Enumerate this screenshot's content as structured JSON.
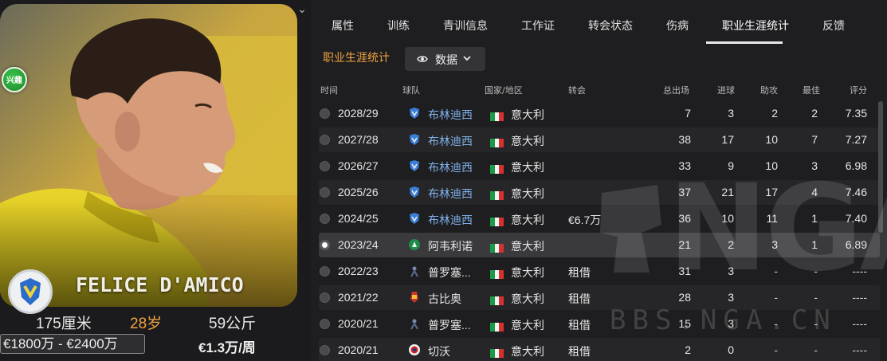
{
  "player": {
    "name": "FELICE D'AMICO",
    "height": "175厘米",
    "age": "28岁",
    "weight": "59公斤",
    "value": "€1800万 - €2400万",
    "wage": "€1.3万/周",
    "interest_badge": "兴趣"
  },
  "tabs": [
    {
      "label": "属性"
    },
    {
      "label": "训练"
    },
    {
      "label": "青训信息"
    },
    {
      "label": "工作证"
    },
    {
      "label": "转会状态"
    },
    {
      "label": "伤病"
    },
    {
      "label": "职业生涯统计"
    },
    {
      "label": "反馈"
    }
  ],
  "active_tab": "职业生涯统计",
  "section": {
    "title": "职业生涯统计",
    "view_button": "数据"
  },
  "table": {
    "headers": {
      "time": "时间",
      "team": "球队",
      "country": "国家/地区",
      "transfer": "转会",
      "apps": "总出场",
      "goals": "进球",
      "assists": "助攻",
      "motm": "最佳",
      "rating": "评分"
    },
    "rows": [
      {
        "season": "2028/29",
        "club": "布林迪西",
        "country": "意大利",
        "fee": "",
        "apps": "7",
        "goals": "3",
        "assists": "2",
        "motm": "2",
        "rating": "7.35"
      },
      {
        "season": "2027/28",
        "club": "布林迪西",
        "country": "意大利",
        "fee": "",
        "apps": "38",
        "goals": "17",
        "assists": "10",
        "motm": "7",
        "rating": "7.27"
      },
      {
        "season": "2026/27",
        "club": "布林迪西",
        "country": "意大利",
        "fee": "",
        "apps": "33",
        "goals": "9",
        "assists": "10",
        "motm": "3",
        "rating": "6.98"
      },
      {
        "season": "2025/26",
        "club": "布林迪西",
        "country": "意大利",
        "fee": "",
        "apps": "37",
        "goals": "21",
        "assists": "17",
        "motm": "4",
        "rating": "7.46"
      },
      {
        "season": "2024/25",
        "club": "布林迪西",
        "country": "意大利",
        "fee": "€6.7万",
        "apps": "36",
        "goals": "10",
        "assists": "11",
        "motm": "1",
        "rating": "7.40"
      },
      {
        "season": "2023/24",
        "club": "阿韦利诺",
        "country": "意大利",
        "fee": "",
        "apps": "21",
        "goals": "2",
        "assists": "3",
        "motm": "1",
        "rating": "6.89"
      },
      {
        "season": "2022/23",
        "club": "普罗塞...",
        "country": "意大利",
        "fee": "租借",
        "apps": "31",
        "goals": "3",
        "assists": "-",
        "motm": "-",
        "rating": "----"
      },
      {
        "season": "2021/22",
        "club": "古比奥",
        "country": "意大利",
        "fee": "租借",
        "apps": "28",
        "goals": "3",
        "assists": "-",
        "motm": "-",
        "rating": "----"
      },
      {
        "season": "2020/21",
        "club": "普罗塞...",
        "country": "意大利",
        "fee": "租借",
        "apps": "15",
        "goals": "3",
        "assists": "-",
        "motm": "-",
        "rating": "----"
      },
      {
        "season": "2020/21",
        "club": "切沃",
        "country": "意大利",
        "fee": "租借",
        "apps": "2",
        "goals": "0",
        "assists": "-",
        "motm": "-",
        "rating": "----"
      }
    ]
  },
  "watermark": {
    "logo": "NGA",
    "site": "BBS.NGA.CN"
  },
  "colors": {
    "accent_orange": "#f0a340",
    "club_link_blue": "#7fb0e8",
    "background": "#1e1e20"
  }
}
